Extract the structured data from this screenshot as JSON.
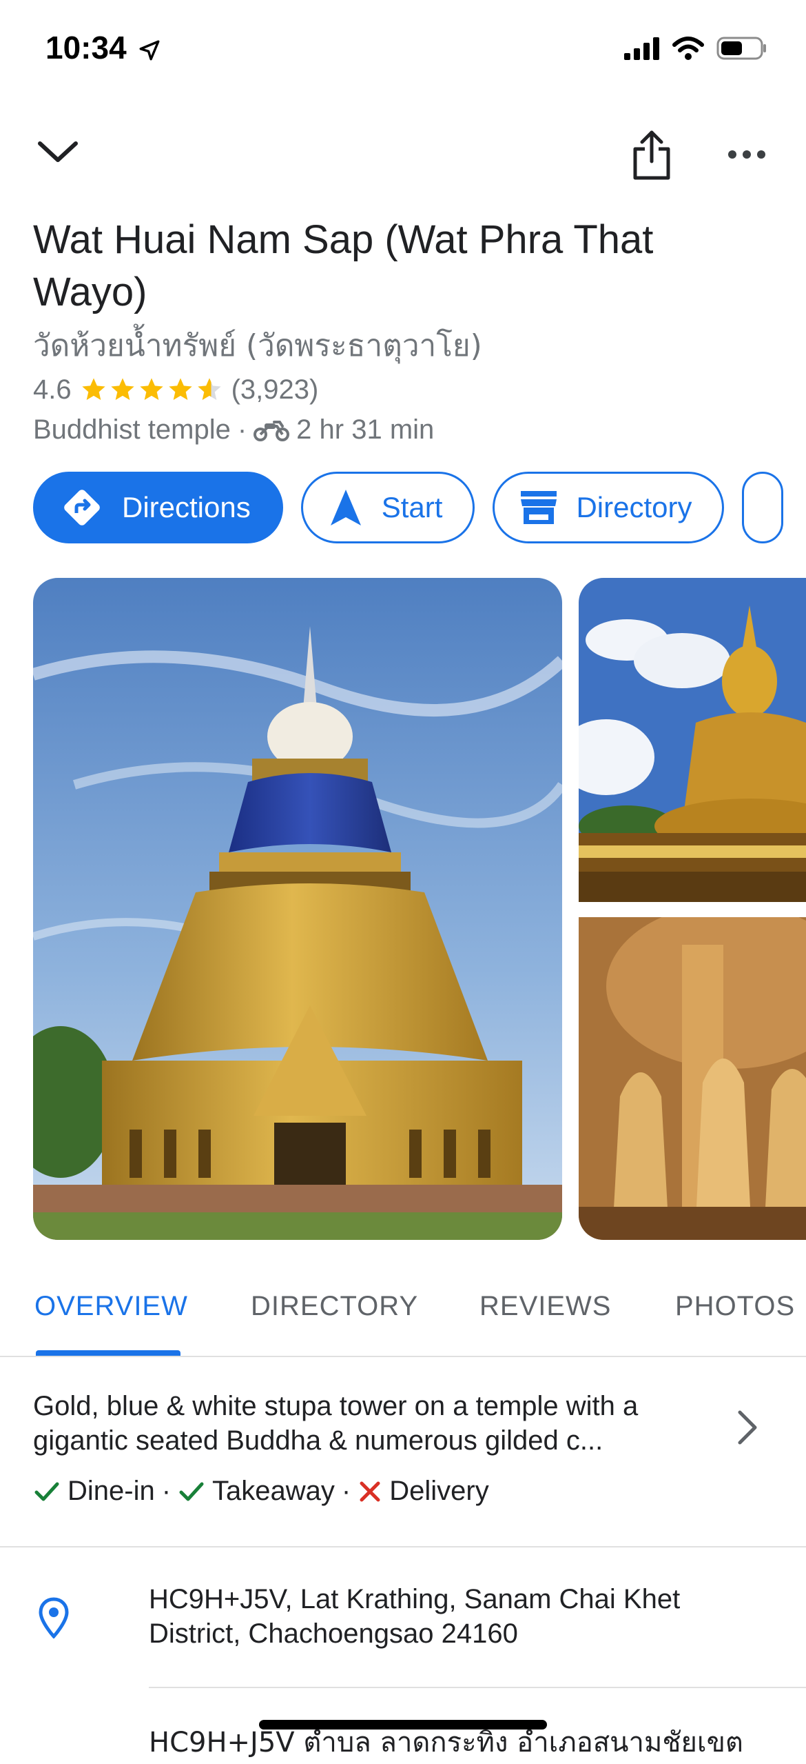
{
  "status_bar": {
    "time": "10:34"
  },
  "place": {
    "name": "Wat Huai Nam Sap (Wat Phra That Wayo)",
    "local_name": "วัดห้วยน้ำทรัพย์ (วัดพระธาตุวาโย)",
    "rating": "4.6",
    "rating_stars": 4.6,
    "review_count": "(3,923)",
    "category": "Buddhist temple",
    "separator": "·",
    "travel_time": "2 hr 31 min"
  },
  "actions": {
    "directions": "Directions",
    "start": "Start",
    "directory": "Directory"
  },
  "tabs": [
    "OVERVIEW",
    "DIRECTORY",
    "REVIEWS",
    "PHOTOS"
  ],
  "overview": {
    "description": "Gold, blue & white stupa tower on a temple with a gigantic seated Buddha & numerous gilded c...",
    "services": [
      {
        "label": "Dine-in",
        "available": true,
        "sep": "·"
      },
      {
        "label": "Takeaway",
        "available": true,
        "sep": "·"
      },
      {
        "label": "Delivery",
        "available": false,
        "sep": ""
      }
    ]
  },
  "address": {
    "plus_code": "HC9H+J5V, Lat Krathing, Sanam Chai Khet District, Chachoengsao 24160",
    "local": "HC9H+J5V ตำบล ลาดกระทิง อำเภอสนามชัยเขต"
  },
  "colors": {
    "accent": "#1a73e8",
    "star": "#fbbc04",
    "check": "#188038",
    "cross": "#d93025",
    "secondary_text": "#70757a"
  }
}
